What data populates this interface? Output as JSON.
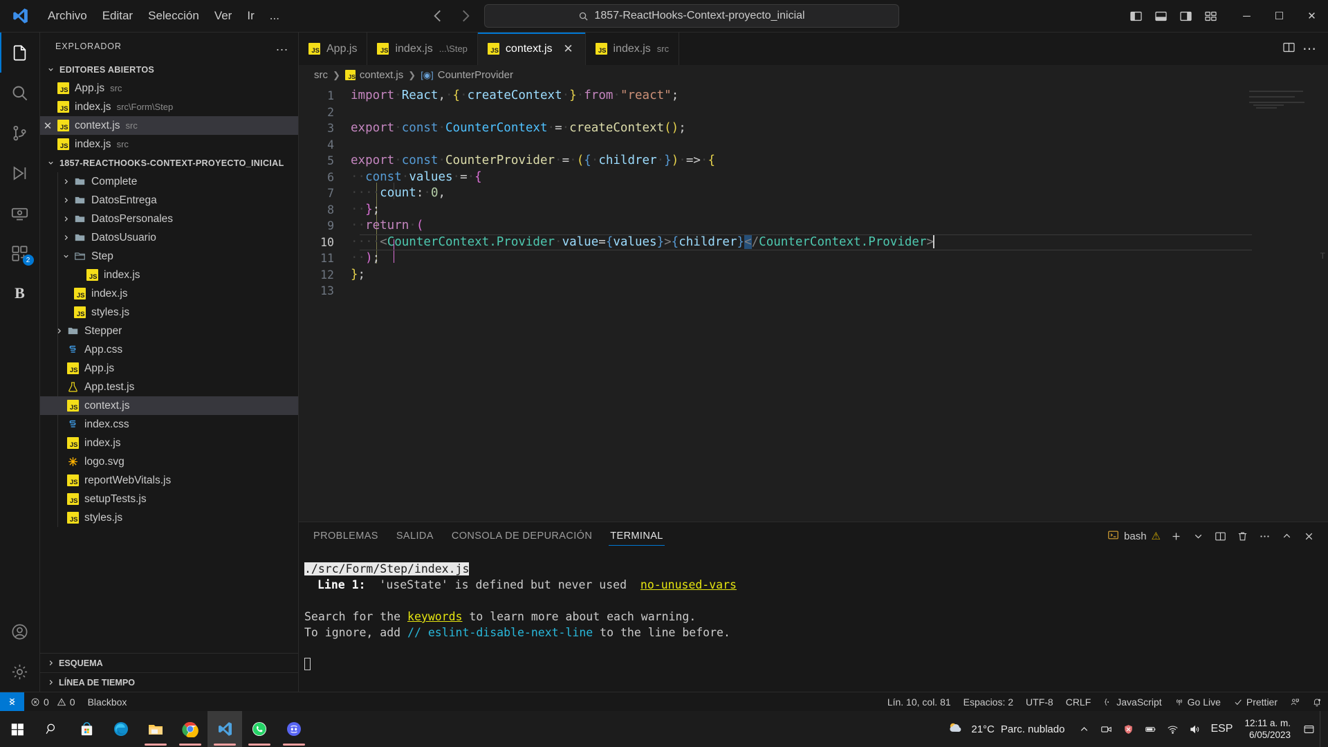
{
  "titlebar": {
    "menu": [
      "Archivo",
      "Editar",
      "Selección",
      "Ver",
      "Ir",
      "..."
    ],
    "search_value": "1857-ReactHooks-Context-proyecto_inicial",
    "back_icon": "arrow-left-icon",
    "forward_icon": "arrow-right-icon",
    "search_icon": "search-icon",
    "layout_icons": [
      "toggle-primary-sidebar-icon",
      "toggle-panel-icon",
      "toggle-secondary-sidebar-icon",
      "customize-layout-icon"
    ],
    "window_buttons": {
      "minimize": "─",
      "maximize": "☐",
      "close": "✕"
    }
  },
  "activitybar": {
    "items": [
      {
        "name": "explorer",
        "icon": "files-icon",
        "active": true,
        "badge": ""
      },
      {
        "name": "search",
        "icon": "search-icon",
        "active": false,
        "badge": ""
      },
      {
        "name": "source-control",
        "icon": "source-control-icon",
        "active": false,
        "badge": ""
      },
      {
        "name": "run-and-debug",
        "icon": "run-debug-icon",
        "active": false,
        "badge": ""
      },
      {
        "name": "remote-explorer",
        "icon": "remote-explorer-icon",
        "active": false,
        "badge": ""
      },
      {
        "name": "extensions",
        "icon": "extensions-icon",
        "active": false,
        "badge": "2"
      },
      {
        "name": "blackbox",
        "icon": "blackbox-b-icon",
        "active": false,
        "badge": ""
      }
    ],
    "bottom": [
      {
        "name": "accounts",
        "icon": "account-icon"
      },
      {
        "name": "manage",
        "icon": "gear-icon"
      }
    ]
  },
  "sidebar": {
    "title": "EXPLORADOR",
    "more_actions": "...",
    "open_editors": {
      "label": "EDITORES ABIERTOS",
      "expanded": true,
      "items": [
        {
          "name": "App.js",
          "path": "src",
          "icon": "js-file-icon",
          "selected": false,
          "has_close": false
        },
        {
          "name": "index.js",
          "path": "src\\Form\\Step",
          "icon": "js-file-icon",
          "selected": false,
          "has_close": false
        },
        {
          "name": "context.js",
          "path": "src",
          "icon": "js-file-icon",
          "selected": true,
          "has_close": true
        },
        {
          "name": "index.js",
          "path": "src",
          "icon": "js-file-icon",
          "selected": false,
          "has_close": false
        }
      ]
    },
    "project": {
      "label": "1857-REACTHOOKS-CONTEXT-PROYECTO_INICIAL",
      "expanded": true,
      "items": [
        {
          "name": "Complete",
          "type": "folder",
          "depth": 1,
          "expanded": false
        },
        {
          "name": "DatosEntrega",
          "type": "folder",
          "depth": 1,
          "expanded": false
        },
        {
          "name": "DatosPersonales",
          "type": "folder",
          "depth": 1,
          "expanded": false
        },
        {
          "name": "DatosUsuario",
          "type": "folder",
          "depth": 1,
          "expanded": false
        },
        {
          "name": "Step",
          "type": "folder",
          "depth": 1,
          "expanded": true
        },
        {
          "name": "index.js",
          "type": "js",
          "depth": 2,
          "expanded": false
        },
        {
          "name": "index.js",
          "type": "js",
          "depth": 1,
          "expanded": false
        },
        {
          "name": "styles.js",
          "type": "js",
          "depth": 1,
          "expanded": false
        },
        {
          "name": "Stepper",
          "type": "folder",
          "depth": 0,
          "expanded": false
        },
        {
          "name": "App.css",
          "type": "css",
          "depth": 0,
          "expanded": false
        },
        {
          "name": "App.js",
          "type": "js",
          "depth": 0,
          "expanded": false
        },
        {
          "name": "App.test.js",
          "type": "test",
          "depth": 0,
          "expanded": false
        },
        {
          "name": "context.js",
          "type": "js",
          "depth": 0,
          "expanded": false,
          "selected": true
        },
        {
          "name": "index.css",
          "type": "css",
          "depth": 0,
          "expanded": false
        },
        {
          "name": "index.js",
          "type": "js",
          "depth": 0,
          "expanded": false
        },
        {
          "name": "logo.svg",
          "type": "svg",
          "depth": 0,
          "expanded": false
        },
        {
          "name": "reportWebVitals.js",
          "type": "js",
          "depth": 0,
          "expanded": false
        },
        {
          "name": "setupTests.js",
          "type": "js",
          "depth": 0,
          "expanded": false
        },
        {
          "name": "styles.js",
          "type": "js",
          "depth": 0,
          "expanded": false
        }
      ]
    },
    "outline_label": "ESQUEMA",
    "timeline_label": "LÍNEA DE TIEMPO"
  },
  "editor": {
    "tabs": [
      {
        "name": "App.js",
        "sub": "",
        "active": false,
        "icon": "js-file-icon",
        "closable": false
      },
      {
        "name": "index.js",
        "sub": "...\\Step",
        "active": false,
        "icon": "js-file-icon",
        "closable": false
      },
      {
        "name": "context.js",
        "sub": "",
        "active": true,
        "icon": "js-file-icon",
        "closable": true
      },
      {
        "name": "index.js",
        "sub": "src",
        "active": false,
        "icon": "js-file-icon",
        "closable": false
      }
    ],
    "tab_overflow_icon": "more-icon",
    "actions": [
      "split-editor-icon",
      "more-actions-icon"
    ],
    "breadcrumb": [
      {
        "text": "src",
        "icon": ""
      },
      {
        "text": "context.js",
        "icon": "js-file-icon"
      },
      {
        "text": "CounterProvider",
        "icon": "symbol-variable-icon"
      }
    ],
    "lines": [
      {
        "n": 1,
        "current": false
      },
      {
        "n": 2,
        "current": false
      },
      {
        "n": 3,
        "current": false
      },
      {
        "n": 4,
        "current": false
      },
      {
        "n": 5,
        "current": false
      },
      {
        "n": 6,
        "current": false
      },
      {
        "n": 7,
        "current": false
      },
      {
        "n": 8,
        "current": false
      },
      {
        "n": 9,
        "current": false
      },
      {
        "n": 10,
        "current": true
      },
      {
        "n": 11,
        "current": false
      },
      {
        "n": 12,
        "current": false
      },
      {
        "n": 13,
        "current": false
      }
    ],
    "source_text": [
      "import React, { createContext } from \"react\";",
      "",
      "export const CounterContext = createContext();",
      "",
      "export const CounterProvider = ({ childrer }) => {",
      "  const values = {",
      "    count: 0,",
      "  };",
      "  return (",
      "    <CounterContext.Provider value={values}>{childrer}</CounterContext.Provider>",
      "  );",
      "};",
      ""
    ]
  },
  "panel": {
    "tabs": [
      {
        "label": "PROBLEMAS",
        "active": false
      },
      {
        "label": "SALIDA",
        "active": false
      },
      {
        "label": "CONSOLA DE DEPURACIÓN",
        "active": false
      },
      {
        "label": "TERMINAL",
        "active": true
      }
    ],
    "shell_label": "bash",
    "shell_icon": "terminal-icon",
    "shell_warning_icon": "warning-icon",
    "actions": [
      "new-terminal-icon",
      "chevron-down-icon",
      "split-terminal-icon",
      "kill-terminal-icon",
      "more-actions-icon",
      "maximize-panel-icon",
      "close-panel-icon"
    ],
    "terminal_lines": [
      {
        "segments": [
          {
            "text": "./src/Form/Step/index.js",
            "style": "highlight"
          }
        ]
      },
      {
        "segments": [
          {
            "text": "  ",
            "style": "plain"
          },
          {
            "text": "Line 1:",
            "style": "bold"
          },
          {
            "text": "  'useState' is defined but never used  ",
            "style": "plain"
          },
          {
            "text": "no-unused-vars",
            "style": "yellow-underline"
          }
        ]
      },
      {
        "segments": [
          {
            "text": "",
            "style": "plain"
          }
        ]
      },
      {
        "segments": [
          {
            "text": "Search for the ",
            "style": "plain"
          },
          {
            "text": "keywords",
            "style": "yellow-underline"
          },
          {
            "text": " to learn more about each warning.",
            "style": "plain"
          }
        ]
      },
      {
        "segments": [
          {
            "text": "To ignore, add ",
            "style": "plain"
          },
          {
            "text": "// eslint-disable-next-line",
            "style": "cyan"
          },
          {
            "text": " to the line before.",
            "style": "plain"
          }
        ]
      },
      {
        "segments": [
          {
            "text": "",
            "style": "plain"
          }
        ]
      },
      {
        "segments": [
          {
            "text": "",
            "style": "cursor"
          }
        ]
      }
    ]
  },
  "statusbar": {
    "remote_icon": "remote-window-icon",
    "errors_icon": "error-icon",
    "errors": "0",
    "warnings_icon": "warning-icon",
    "warnings": "0",
    "blackbox": "Blackbox",
    "cursor_position": "Lín. 10, col. 81",
    "indentation": "Espacios: 2",
    "encoding": "UTF-8",
    "eol": "CRLF",
    "language_icon": "braces-icon",
    "language": "JavaScript",
    "golive_icon": "broadcast-icon",
    "golive": "Go Live",
    "prettier_icon": "check-icon",
    "prettier": "Prettier",
    "feedback_icon": "feedback-icon",
    "bell_icon": "bell-dot-icon"
  },
  "taskbar": {
    "items": [
      {
        "name": "start",
        "icon": "windows-logo-icon",
        "open": false,
        "focused": false
      },
      {
        "name": "search",
        "icon": "search-icon",
        "open": false,
        "focused": false
      },
      {
        "name": "microsoft-store",
        "icon": "store-icon",
        "open": false,
        "focused": false
      },
      {
        "name": "microsoft-edge",
        "icon": "edge-icon",
        "open": false,
        "focused": false
      },
      {
        "name": "file-explorer",
        "icon": "folder-icon",
        "open": true,
        "focused": false
      },
      {
        "name": "google-chrome",
        "icon": "chrome-icon",
        "open": true,
        "focused": false
      },
      {
        "name": "visual-studio-code",
        "icon": "vscode-icon",
        "open": true,
        "focused": true
      },
      {
        "name": "whatsapp",
        "icon": "whatsapp-icon",
        "open": true,
        "focused": false
      },
      {
        "name": "discord",
        "icon": "discord-icon",
        "open": true,
        "focused": false
      }
    ],
    "tray": {
      "chevron_icon": "chevron-up-icon",
      "icons": [
        "meet-now-icon",
        "antivirus-icon",
        "battery-icon",
        "network-icon",
        "volume-icon"
      ],
      "language": "ESP",
      "weather_icon": "cloudy-icon",
      "weather_temp": "21°C",
      "weather_desc": "Parc. nublado",
      "time": "12:11 a. m.",
      "date": "6/05/2023",
      "notifications_icon": "notification-icon"
    }
  }
}
